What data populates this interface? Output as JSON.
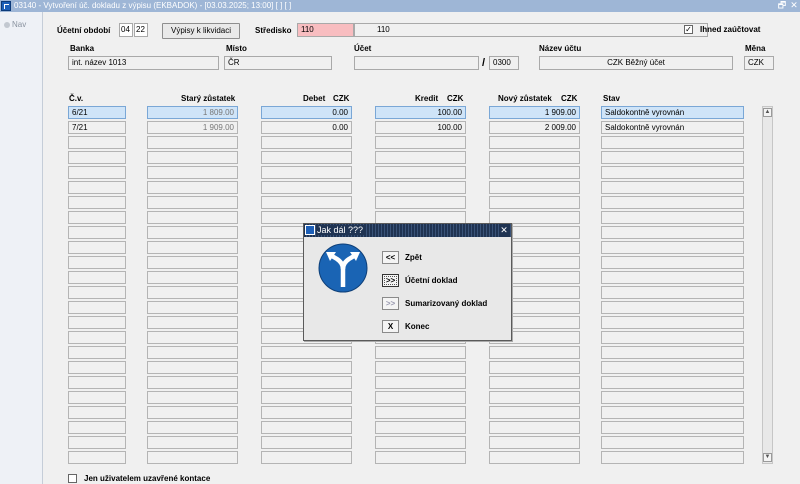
{
  "window": {
    "title": "03140 - Vytvoření úč. dokladu z výpisu (EKBADOK) - [03.03.2025; 13:00]  [ ] [ ]",
    "restore_glyph": "🗗",
    "close_glyph": "✕"
  },
  "leftnav": {
    "label": "Nav"
  },
  "form": {
    "ucetni_obdobi_label": "Účetní období",
    "obdobi_mesic": "04",
    "obdobi_rok": "22",
    "vypisy_button": "Výpisy k likvidaci",
    "stredisko_label": "Středisko",
    "stredisko_code": "110",
    "stredisko_name": "110",
    "ihned_label": "Ihned zaúčtovat",
    "ihned_checked": "✓",
    "banka_label": "Banka",
    "banka_value": "int. název 1013",
    "misto_label": "Místo",
    "misto_value": "ČR",
    "ucet_label": "Účet",
    "ucet_value": "",
    "slash": "/",
    "kod_banky": "0300",
    "nazev_uctu_label": "Název účtu",
    "nazev_uctu_value": "CZK Běžný účet",
    "mena_label": "Měna",
    "mena_value": "CZK",
    "footer_label": "Jen uživatelem uzavřené kontace"
  },
  "table": {
    "headers": {
      "cv": "Č.v.",
      "stary": "Starý zůstatek",
      "debet": "Debet",
      "debet_cur": "CZK",
      "kredit": "Kredit",
      "kredit_cur": "CZK",
      "novy": "Nový zůstatek",
      "novy_cur": "CZK",
      "stav": "Stav"
    },
    "rows": [
      {
        "cv": "6/21",
        "stary": "1 809.00",
        "debet": "0.00",
        "kredit": "100.00",
        "novy": "1 909.00",
        "stav": "Saldokontně vyrovnán"
      },
      {
        "cv": "7/21",
        "stary": "1 909.00",
        "debet": "0.00",
        "kredit": "100.00",
        "novy": "2 009.00",
        "stav": "Saldokontně vyrovnán"
      }
    ],
    "scroll_up": "▲",
    "scroll_down": "▼"
  },
  "dialog": {
    "title": "Jak dál ???",
    "close": "✕",
    "options": [
      {
        "glyph": "<<",
        "label": "Zpět"
      },
      {
        "glyph": ">>",
        "label": "Účetní doklad"
      },
      {
        "glyph": ">>",
        "label": "Sumarizovaný doklad"
      },
      {
        "glyph": "X",
        "label": "Konec"
      }
    ]
  },
  "colors": {
    "titlebar": "#9eb6d6",
    "selected_row": "#cfe4f8",
    "stredisko_highlight": "#f8bdc0",
    "dialog_title": "#1f3352",
    "sign_blue": "#1a64b4"
  }
}
